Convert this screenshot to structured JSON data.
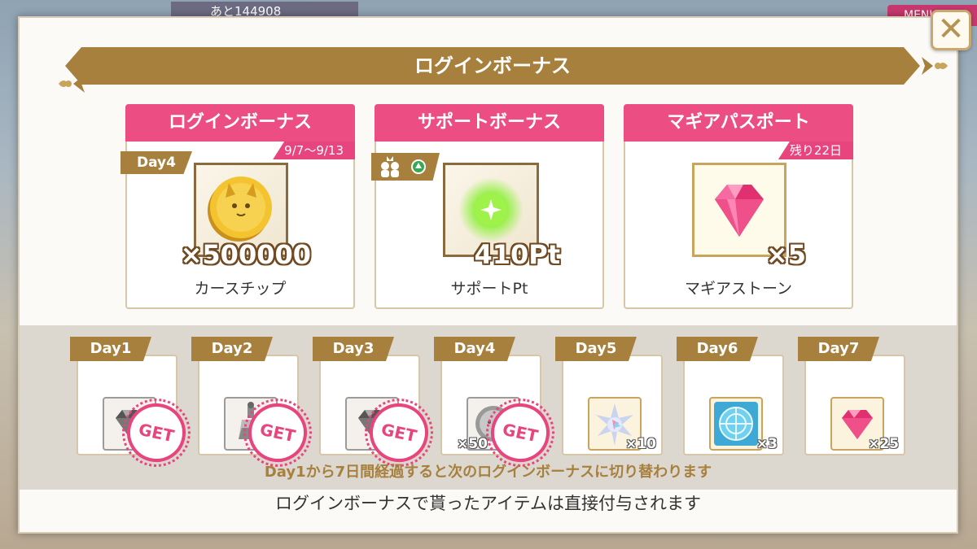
{
  "background": {
    "counter_text": "あと144908",
    "menu_label": "MENU"
  },
  "dialog": {
    "title": "ログインボーナス",
    "close_label": "✕",
    "cards": [
      {
        "header": "ログインボーナス",
        "subtag": "9/7〜9/13",
        "day_tag": "Day4",
        "item_icon": "cat-coin-icon",
        "quantity": "×500000",
        "item_name": "カースチップ"
      },
      {
        "header": "サポートボーナス",
        "item_icon": "support-point-icon",
        "quantity": "410Pt",
        "item_name": "サポートPt"
      },
      {
        "header": "マギアパスポート",
        "subtag": "残り22日",
        "item_icon": "magia-stone-icon",
        "quantity": "×5",
        "item_name": "マギアストーン"
      }
    ],
    "days": [
      {
        "label": "Day1",
        "icon": "gray-gem-icon",
        "qty": "",
        "claimed": true,
        "stamp": "GET"
      },
      {
        "label": "Day2",
        "icon": "gray-potion-icon",
        "qty": "",
        "claimed": true,
        "stamp": "GET"
      },
      {
        "label": "Day3",
        "icon": "gray-gem-icon",
        "qty": "",
        "claimed": true,
        "stamp": "GET"
      },
      {
        "label": "Day4",
        "icon": "gray-coin-icon",
        "qty": "×50",
        "claimed": true,
        "stamp": "GET"
      },
      {
        "label": "Day5",
        "icon": "star-crystal-icon",
        "qty": "×10",
        "claimed": false
      },
      {
        "label": "Day6",
        "icon": "blue-disc-icon",
        "qty": "×3",
        "claimed": false
      },
      {
        "label": "Day7",
        "icon": "pink-gem-icon",
        "qty": "×25",
        "claimed": false
      }
    ],
    "notice": "Day1から7日間経過すると次のログインボーナスに切り替わります",
    "footer": "ログインボーナスで貰ったアイテムは直接付与されます"
  },
  "colors": {
    "accent_pink": "#ec4e83",
    "accent_gold": "#a7803e"
  }
}
